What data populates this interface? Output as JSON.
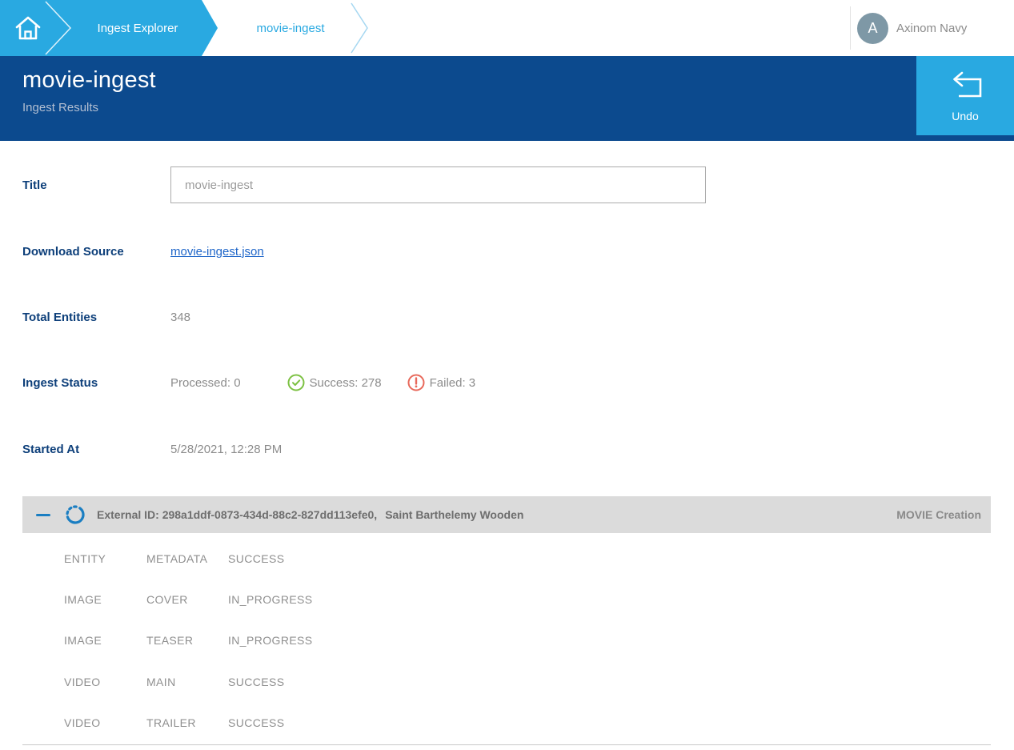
{
  "breadcrumb": {
    "items": [
      {
        "label": "Ingest Explorer"
      },
      {
        "label": "movie-ingest"
      }
    ]
  },
  "user": {
    "initial": "A",
    "name": "Axinom Navy"
  },
  "header": {
    "title": "movie-ingest",
    "subtitle": "Ingest Results",
    "undo_label": "Undo"
  },
  "form": {
    "fields": [
      {
        "label": "Title",
        "value": "movie-ingest"
      },
      {
        "label": "Download Source",
        "value": "movie-ingest.json"
      },
      {
        "label": "Total Entities",
        "value": "348"
      },
      {
        "label": "Ingest Status",
        "processed": "Processed: 0",
        "success": "Success: 278",
        "failed": "Failed: 3"
      },
      {
        "label": "Started At",
        "value": "5/28/2021, 12:28 PM"
      }
    ]
  },
  "ingest_item": {
    "external_id_text": "External ID: 298a1ddf-0873-434d-88c2-827dd113efe0,",
    "title": "Saint Barthelemy Wooden",
    "type_label": "MOVIE Creation",
    "rows": [
      {
        "entity": "ENTITY",
        "sub": "METADATA",
        "status": "SUCCESS"
      },
      {
        "entity": "IMAGE",
        "sub": "COVER",
        "status": "IN_PROGRESS"
      },
      {
        "entity": "IMAGE",
        "sub": "TEASER",
        "status": "IN_PROGRESS"
      },
      {
        "entity": "VIDEO",
        "sub": "MAIN",
        "status": "SUCCESS"
      },
      {
        "entity": "VIDEO",
        "sub": "TRAILER",
        "status": "SUCCESS"
      }
    ]
  },
  "icons": {
    "home": "home-icon",
    "undo": "undo-arrow-icon",
    "collapse": "minus-icon",
    "in_progress": "spinner-icon",
    "success": "check-circle-icon",
    "failed": "error-circle-icon"
  },
  "colors": {
    "accent_blue": "#29a9e1",
    "header_navy": "#0c4a8e",
    "label_navy": "#0d3f7a",
    "link_blue": "#1f66c9",
    "success_green": "#7cc142",
    "failed_red": "#e8685a",
    "item_bar_gray": "#dbdbdb"
  }
}
